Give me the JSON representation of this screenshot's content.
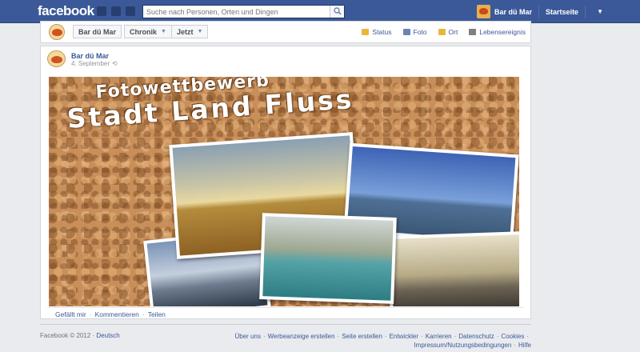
{
  "topbar": {
    "logo": "facebook",
    "search_placeholder": "Suche nach Personen, Orten und Dingen",
    "user_name": "Bar dü Mar",
    "home_label": "Startseite",
    "jewels": [
      "friend-requests-icon",
      "messages-icon",
      "notifications-icon"
    ]
  },
  "timeline_bar": {
    "page_name": "Bar dü Mar",
    "chronik_label": "Chronik",
    "jetzt_label": "Jetzt",
    "composer": [
      {
        "label": "Status",
        "icon": "status-icon",
        "color": "#e9b83b"
      },
      {
        "label": "Foto",
        "icon": "photo-icon",
        "color": "#6d84b4"
      },
      {
        "label": "Ort",
        "icon": "place-icon",
        "color": "#e9b83b"
      },
      {
        "label": "Lebensereignis",
        "icon": "life-event-icon",
        "color": "#7f7f7f"
      }
    ]
  },
  "post": {
    "author": "Bar dü Mar",
    "date": "4. September",
    "photo_title_line1": "Fotowettbewerb",
    "photo_title_line2": "Stadt Land Fluss",
    "actions": [
      "Gefällt mir",
      "Kommentieren",
      "Teilen"
    ]
  },
  "footer": {
    "copyright": "Facebook © 2012 · ",
    "language": "Deutsch",
    "links": [
      "Über uns",
      "Werbeanzeige erstellen",
      "Seite erstellen",
      "Entwickler",
      "Karrieren",
      "Datenschutz",
      "Cookies",
      "Impressum/Nutzungsbedingungen",
      "Hilfe"
    ]
  },
  "colors": {
    "brand_blue": "#3b5998",
    "link_blue": "#3b5998",
    "background": "#e9ebee"
  }
}
